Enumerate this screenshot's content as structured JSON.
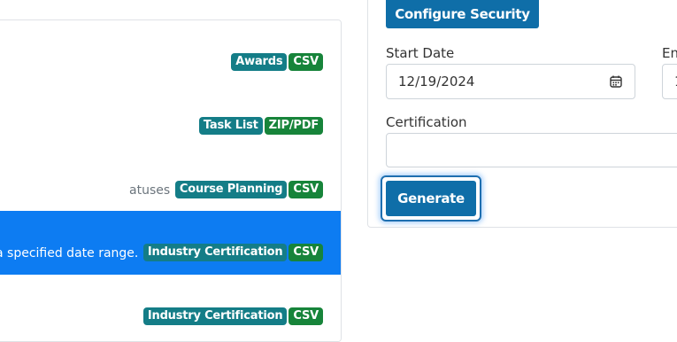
{
  "reports": [
    {
      "text": "",
      "type": "Awards",
      "format": "CSV",
      "active": false
    },
    {
      "text": "",
      "type": "Task List",
      "format": "ZIP/PDF",
      "active": false
    },
    {
      "text": "atuses",
      "type": "Course Planning",
      "format": "CSV",
      "active": false
    },
    {
      "text": "a specified date range.",
      "type": "Industry Certification",
      "format": "CSV",
      "active": true
    },
    {
      "text": "",
      "type": "Industry Certification",
      "format": "CSV",
      "active": false
    }
  ],
  "side": {
    "configure_security": "Configure Security",
    "start_date_label": "Start Date",
    "start_date_value": "12/19/2024",
    "end_date_label": "En",
    "end_date_value": "1",
    "certification_label": "Certification",
    "certification_value": "",
    "generate": "Generate"
  },
  "icons": {
    "calendar": "calendar-icon"
  },
  "colors": {
    "active_row": "#0d7cf2",
    "type_badge": "#147d87",
    "format_badge": "#17843a",
    "button": "#0f6ea8"
  }
}
